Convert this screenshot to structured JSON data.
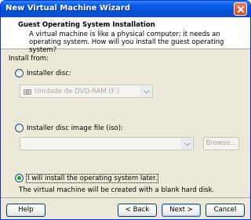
{
  "window": {
    "title": "New Virtual Machine Wizard"
  },
  "header": {
    "title": "Guest Operating System Installation",
    "description": "A virtual machine is like a physical computer; it needs an operating system. How will you install the guest operating system?"
  },
  "install_from": {
    "label": "Install from:",
    "options": [
      {
        "label": "Installer disc:",
        "selected": false
      },
      {
        "label": "Installer disc image file (iso):",
        "selected": false
      },
      {
        "label": "I will install the operating system later.",
        "selected": true
      }
    ],
    "disc_combo_value": "Unidade de DVD-RAM (F:)",
    "iso_combo_value": "",
    "browse_label": "Browse...",
    "later_note": "The virtual machine will be created with a blank hard disk."
  },
  "buttons": {
    "help": "Help",
    "back": "< Back",
    "next": "Next >",
    "cancel": "Cancel"
  },
  "colors": {
    "titlebar": "#0a5ee6",
    "dialog_bg": "#ece9d8",
    "radio_checked": "#21a121"
  },
  "icons": {
    "close": "close-icon",
    "disc_drive": "dvd-drive-icon",
    "dropdown": "chevron-down-icon"
  }
}
